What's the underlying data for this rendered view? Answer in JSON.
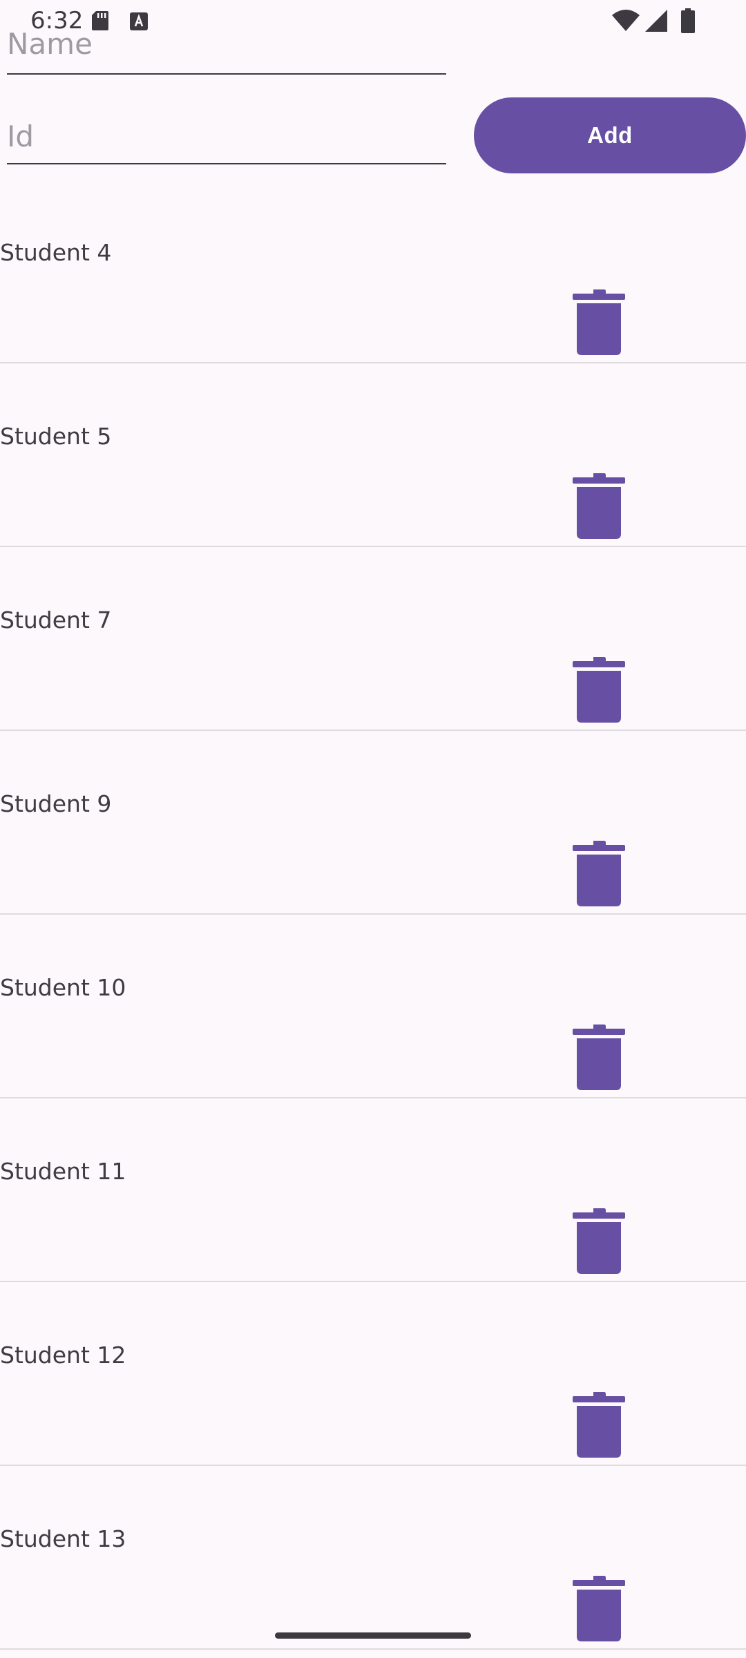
{
  "status_bar": {
    "time": "6:32",
    "icons": [
      "sd-card-icon",
      "keyboard-a-icon",
      "wifi-icon",
      "signal-icon",
      "battery-icon"
    ]
  },
  "form": {
    "name_placeholder": "Name",
    "name_value": "",
    "id_placeholder": "Id",
    "id_value": "",
    "add_label": "Add"
  },
  "students": [
    {
      "name": "Student 4"
    },
    {
      "name": "Student 5"
    },
    {
      "name": "Student 7"
    },
    {
      "name": "Student 9"
    },
    {
      "name": "Student 10"
    },
    {
      "name": "Student 11"
    },
    {
      "name": "Student 12"
    },
    {
      "name": "Student 13"
    }
  ],
  "colors": {
    "accent": "#6750a4",
    "background": "#fdf8fc",
    "text": "#3f3b42",
    "divider": "#dedade"
  }
}
